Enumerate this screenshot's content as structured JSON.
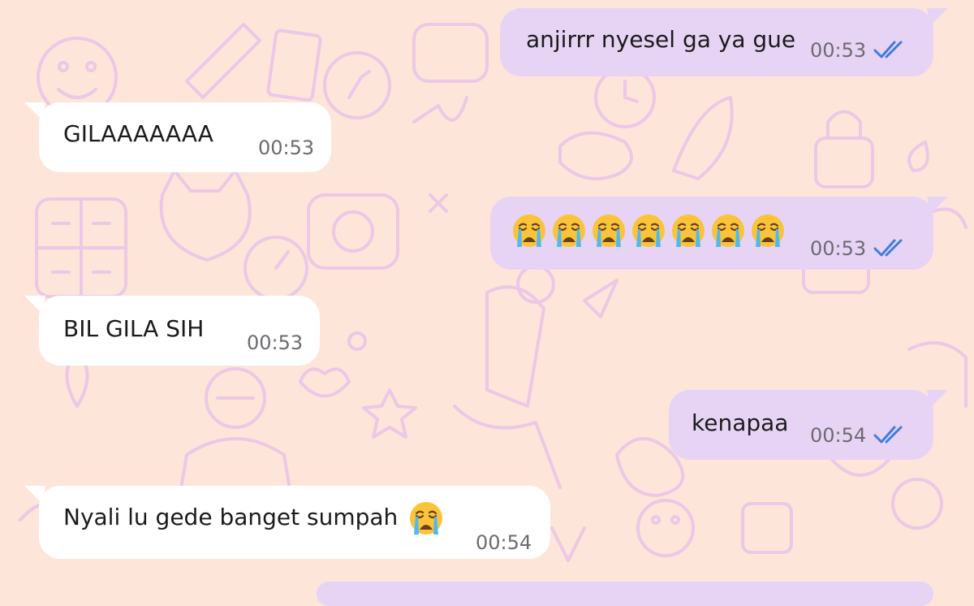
{
  "colors": {
    "chat_background": "#fde5da",
    "wallpaper_doodle": "#e9c9ea",
    "incoming_bubble": "#ffffff",
    "outgoing_bubble": "#e7d4f5",
    "read_ticks": "#3c7de0",
    "timestamp": "#6e6a70"
  },
  "messages": [
    {
      "direction": "outgoing",
      "text": "anjirrr nyesel ga ya gue",
      "time": "00:53",
      "status": "read"
    },
    {
      "direction": "incoming",
      "text": "GILAAAAAAA",
      "time": "00:53"
    },
    {
      "direction": "outgoing",
      "emoji": "loudly-crying-face",
      "emoji_count": 7,
      "time": "00:53",
      "status": "read"
    },
    {
      "direction": "incoming",
      "text": "BIL GILA SIH",
      "time": "00:53"
    },
    {
      "direction": "outgoing",
      "text": "kenapaa",
      "time": "00:54",
      "status": "read"
    },
    {
      "direction": "incoming",
      "text": "Nyali lu gede banget sumpah",
      "emoji": "loudly-crying-face",
      "time": "00:54"
    }
  ]
}
